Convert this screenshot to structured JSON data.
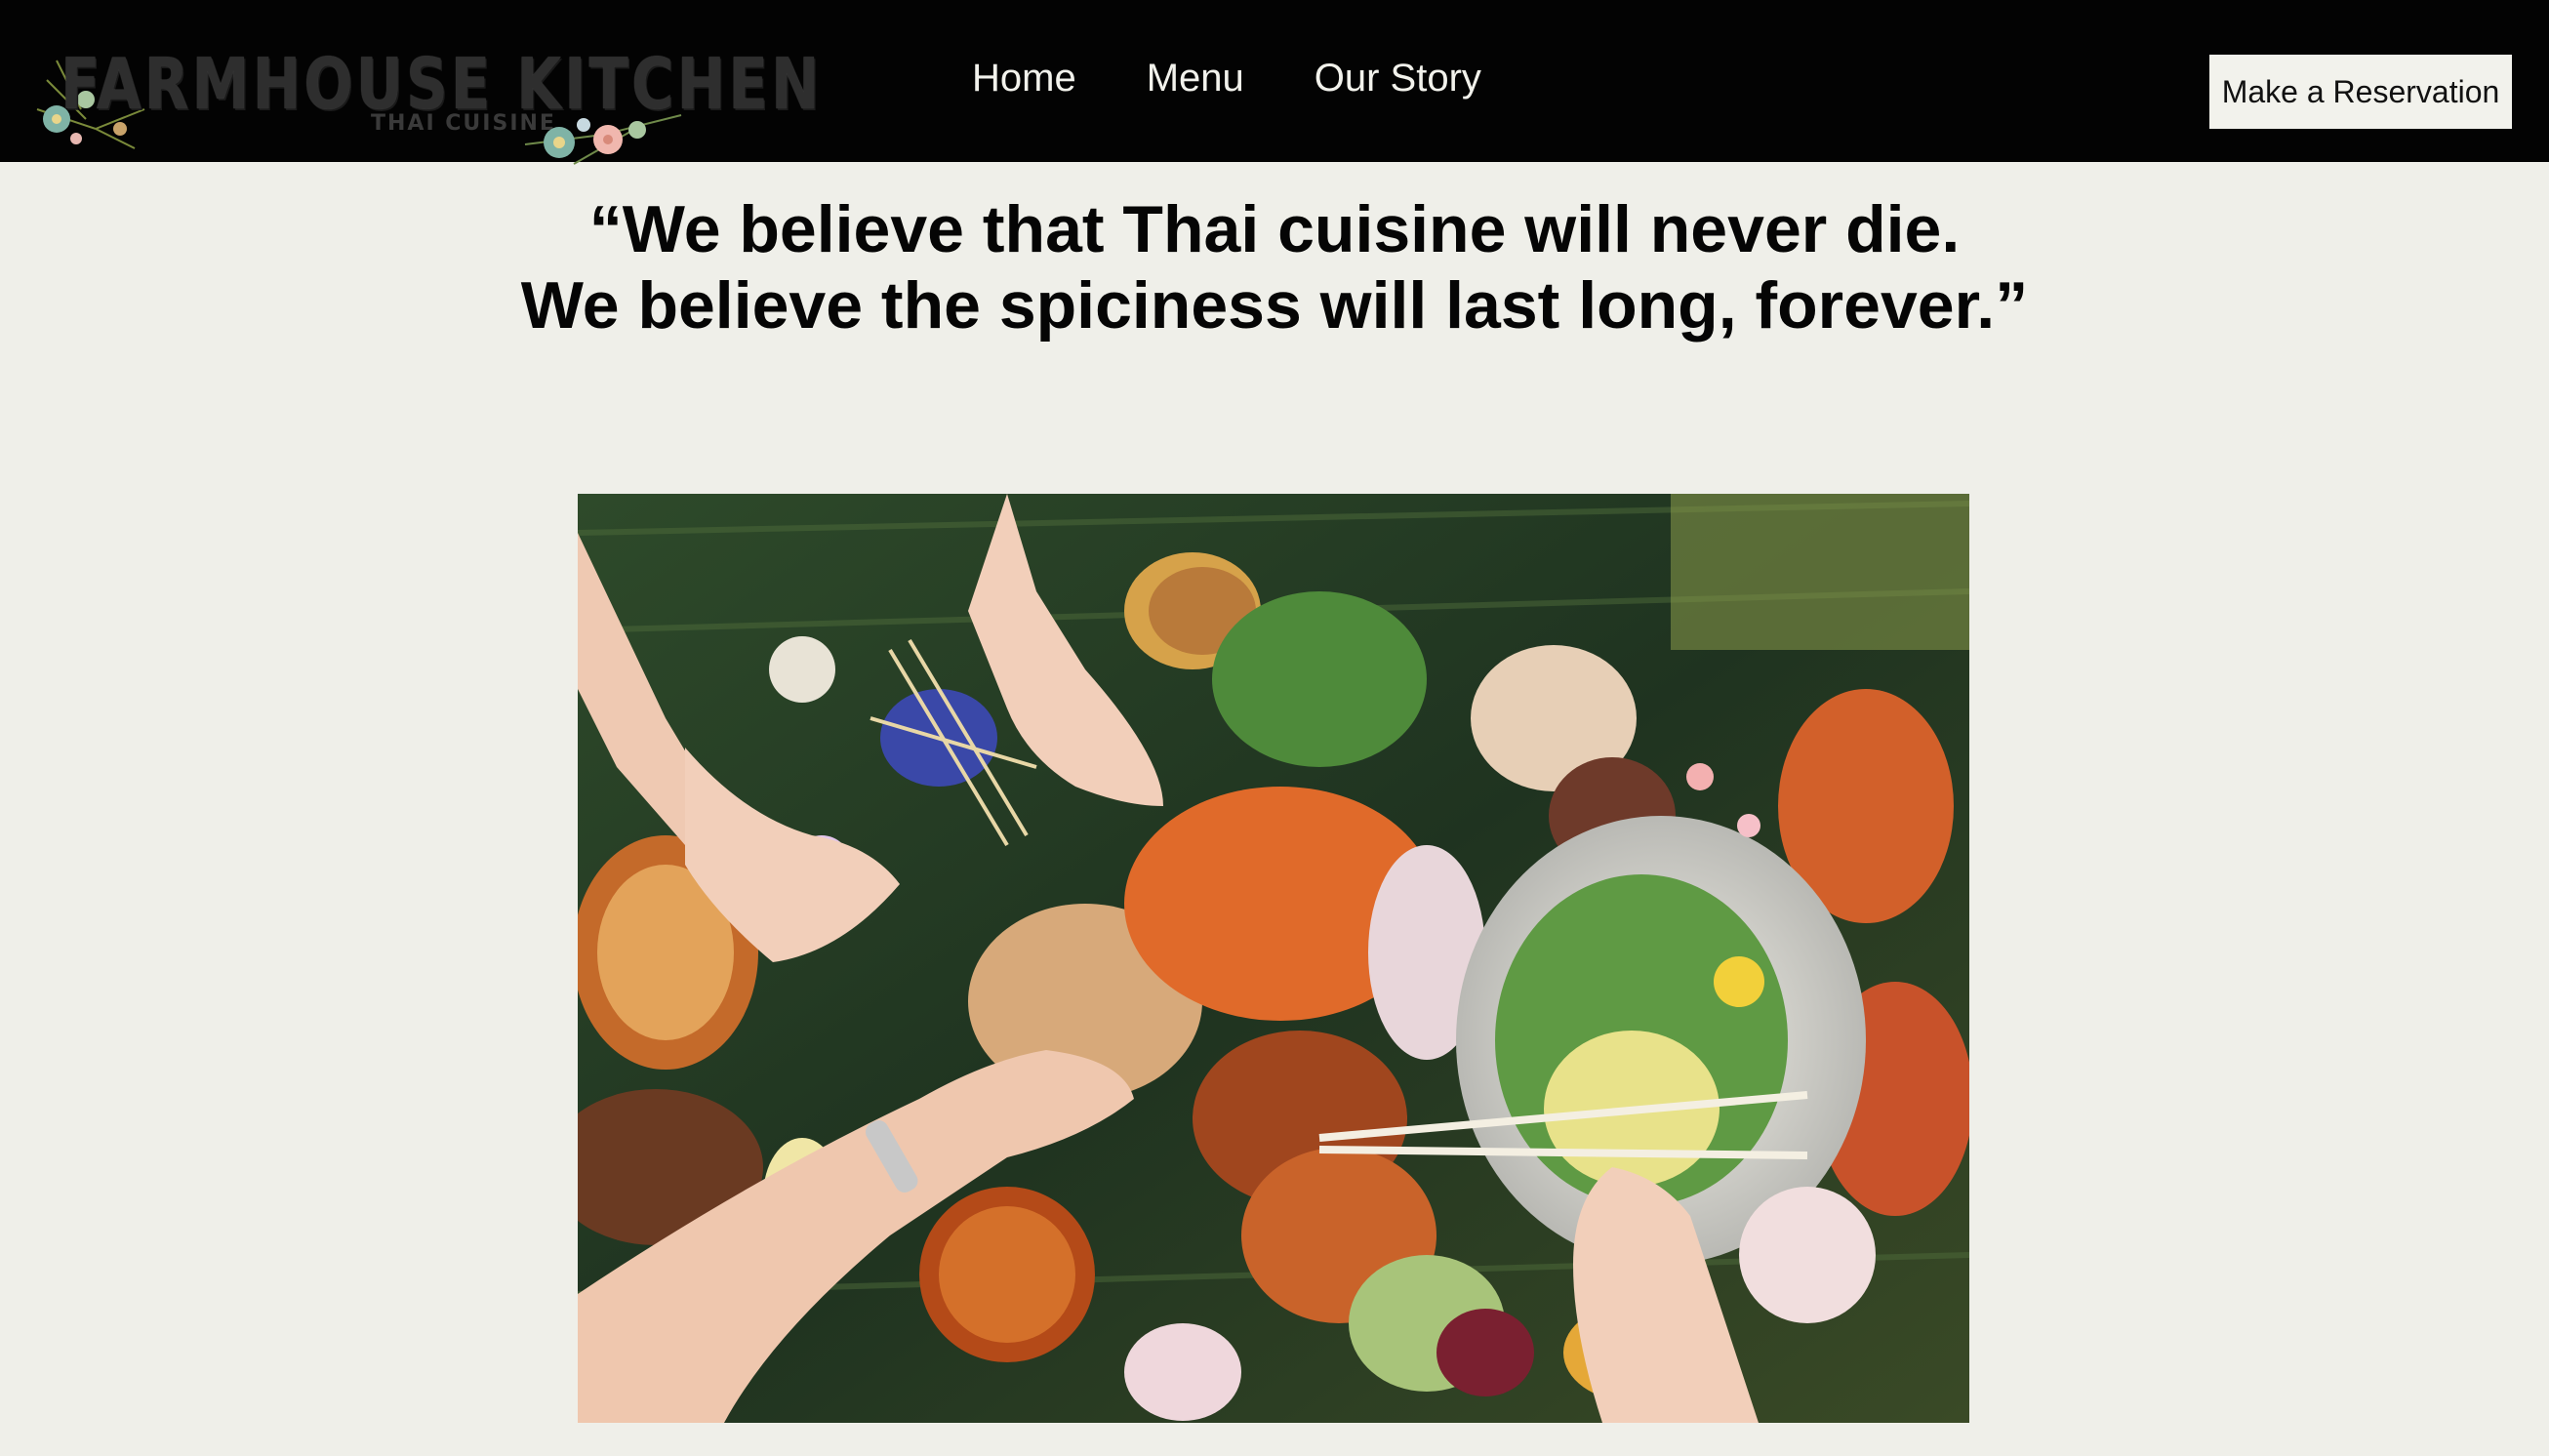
{
  "header": {
    "logo": {
      "title": "FARMHOUSE KITCHEN",
      "subtitle": "THAI CUISINE"
    },
    "nav": [
      {
        "label": "Home"
      },
      {
        "label": "Menu"
      },
      {
        "label": "Our Story"
      }
    ],
    "reservation_button": "Make a Reservation"
  },
  "quote": {
    "line1": "“We believe that Thai cuisine will never die.",
    "line2": "We believe the spiciness will last long, forever.”"
  },
  "colors": {
    "header_bg": "#030303",
    "page_bg": "#efefe9",
    "nav_text": "#f2f2ec",
    "button_bg": "#f2f2ec"
  }
}
